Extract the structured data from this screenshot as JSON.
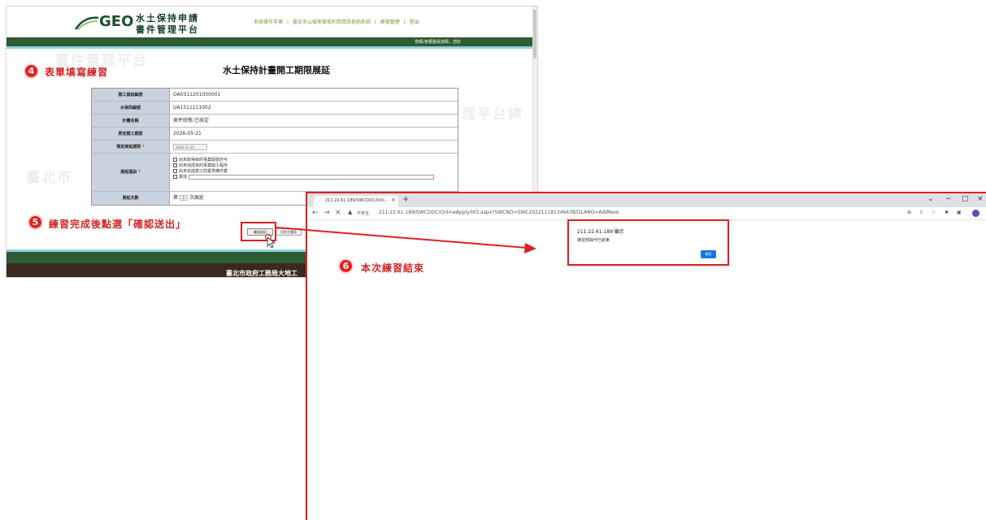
{
  "site": {
    "logo_geo": "GEO",
    "logo_line1": "水土保持申請",
    "logo_line2": "書件管理平台",
    "top_links": [
      "系統操作手冊",
      "|",
      "臺北市山坡地保育利用資訊查詢系統",
      "|",
      "帳號管理",
      "|",
      "登出"
    ],
    "greeting": "技師/各類委員技師，您好",
    "watermark_top": "書件管理平台",
    "watermark_left": "臺北市",
    "watermark_right": "理平台練",
    "footer_text": "臺北市政府工務局大地工"
  },
  "steps": {
    "step4": {
      "number": "4",
      "text": "表單填寫練習"
    },
    "step5": {
      "number": "5",
      "text": "練習完成後點選「確認送出」"
    },
    "step6": {
      "number": "6",
      "text": "本次練習結束"
    }
  },
  "form": {
    "title": "水土保持計畫開工期限展延",
    "rows": {
      "case_no": {
        "label": "開工展延編號",
        "value": "OA0311201000001"
      },
      "bureau_no": {
        "label": "水保局編號",
        "value": "UA1511111002"
      },
      "plan_name": {
        "label": "計畫名稱",
        "value": "案件狀態:已核定"
      },
      "original_date": {
        "label": "原定開工期限",
        "value": "2026-05-21"
      },
      "extended_date": {
        "label": "預定展延期限",
        "required": "*",
        "value": "2026-11-21"
      },
      "reason": {
        "label": "展延理由",
        "required": "*",
        "options": [
          "尚未取得目的事業開發許可",
          "尚未完成目的事業開工程序",
          "尚未完成施工前置準備作業"
        ],
        "other_label": "其他"
      },
      "times": {
        "label": "展延次數",
        "prefix": "第",
        "value": "1",
        "suffix": "次展延"
      }
    },
    "submit_label": "確認送出",
    "cancel_label": "回到主畫面"
  },
  "browser": {
    "tab_title": "211.22.61.189/SWCDOC/Onli...",
    "tab_close": "×",
    "new_tab": "+",
    "win_controls": [
      "⌄",
      "−",
      "▢",
      "×"
    ],
    "insecure_label": "不安全",
    "url": "211.22.61.189/SWCDOC/OnlineApply003.aspx?SWCNO=SWC202211181346438/OLANO=AddNew",
    "dialog": {
      "origin": "211.22.61.189 顯示",
      "message": "練習部操作已結束",
      "ok_label": "確定"
    }
  },
  "colors": {
    "accent_red": "#e02020",
    "nav_green": "#2e5b32",
    "label_bg": "#c9d2de",
    "chrome_blue": "#1a73e8"
  }
}
